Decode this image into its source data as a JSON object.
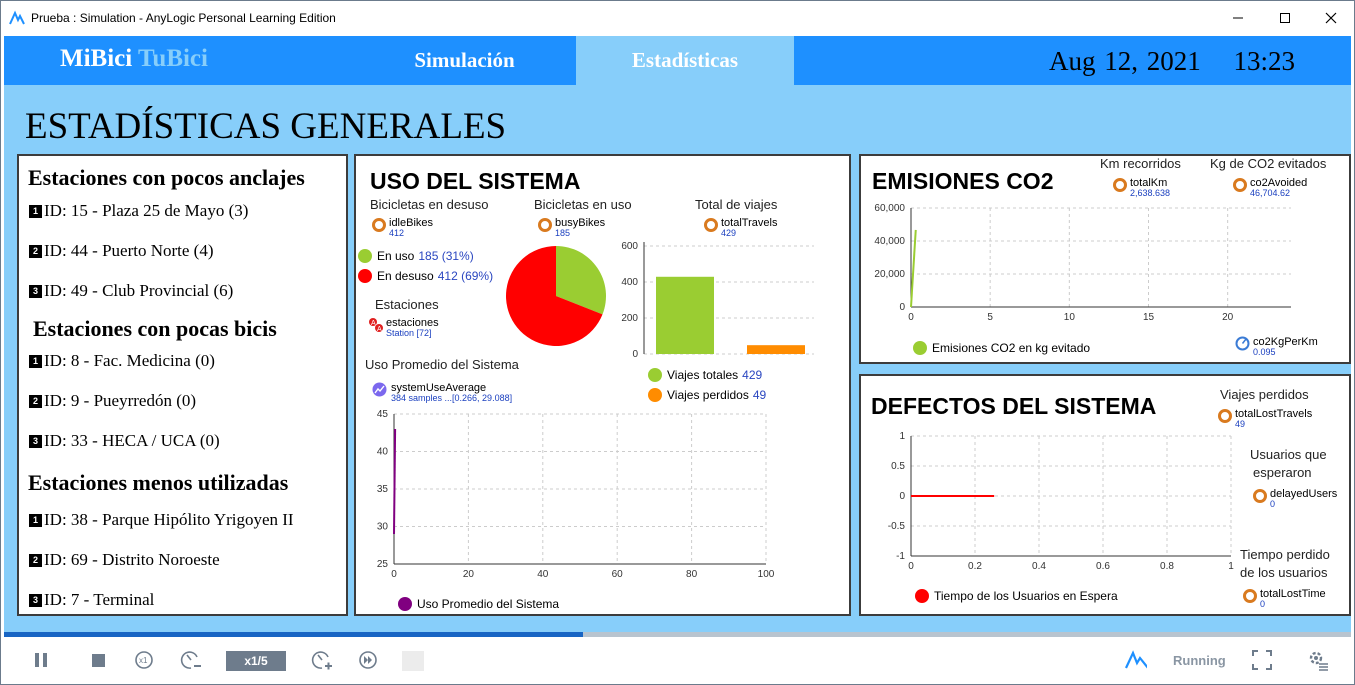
{
  "window": {
    "title": "Prueba : Simulation - AnyLogic Personal Learning Edition"
  },
  "nav": {
    "brand1": "MiBici",
    "brand2": "TuBici",
    "tabs": [
      "Simulación",
      "Estadísticas"
    ],
    "date": "Aug 12, 2021",
    "time": "13:23"
  },
  "page": {
    "title": "ESTADÍSTICAS GENERALES"
  },
  "rankings": {
    "groups": [
      {
        "title": "Estaciones con pocos anclajes",
        "items": [
          {
            "n": "1",
            "text": "ID: 15 - Plaza 25 de Mayo (3)"
          },
          {
            "n": "2",
            "text": "ID: 44 - Puerto Norte (4)"
          },
          {
            "n": "3",
            "text": "ID: 49 - Club Provincial (6)"
          }
        ]
      },
      {
        "title": "Estaciones con pocas bicis",
        "items": [
          {
            "n": "1",
            "text": "ID: 8 - Fac. Medicina (0)"
          },
          {
            "n": "2",
            "text": "ID: 9 - Pueyrredón (0)"
          },
          {
            "n": "3",
            "text": "ID: 33 - HECA / UCA (0)"
          }
        ]
      },
      {
        "title": "Estaciones menos utilizadas",
        "items": [
          {
            "n": "1",
            "text": "ID: 38 - Parque Hipólito Yrigoyen II"
          },
          {
            "n": "2",
            "text": "ID: 69 - Distrito Noroeste"
          },
          {
            "n": "3",
            "text": "ID: 7 - Terminal"
          }
        ]
      }
    ]
  },
  "uso": {
    "title": "USO DEL SISTEMA",
    "lbl_desuso": "Bicicletas en desuso",
    "lbl_enuso": "Bicicletas en uso",
    "lbl_total": "Total de viajes",
    "idle": {
      "name": "idleBikes",
      "value": "412"
    },
    "busy": {
      "name": "busyBikes",
      "value": "185"
    },
    "travels": {
      "name": "totalTravels",
      "value": "429"
    },
    "leg_enuso": "En uso",
    "leg_enuso_val": "185 (31%)",
    "leg_desuso": "En desuso",
    "leg_desuso_val": "412 (69%)",
    "lbl_estaciones": "Estaciones",
    "estaciones": {
      "name": "estaciones",
      "value": "Station [72]"
    },
    "lbl_promedio": "Uso Promedio del Sistema",
    "avg": {
      "name": "systemUseAverage",
      "value": "384 samples ...[0.266, 29.088]"
    },
    "leg_viajes_totales": "Viajes totales",
    "leg_viajes_totales_val": "429",
    "leg_viajes_perdidos": "Viajes perdidos",
    "leg_viajes_perdidos_val": "49",
    "leg_promedio": "Uso Promedio del Sistema"
  },
  "emis": {
    "title": "EMISIONES CO2",
    "lbl_km": "Km recorridos",
    "lbl_kg": "Kg de CO2 evitados",
    "km": {
      "name": "totalKm",
      "value": "2,638.638"
    },
    "co2": {
      "name": "co2Avoided",
      "value": "46,704.62"
    },
    "leg": "Emisiones CO2 en kg evitado",
    "perkm": {
      "name": "co2KgPerKm",
      "value": "0.095"
    }
  },
  "defectos": {
    "title": "DEFECTOS DEL SISTEMA",
    "lbl_perdidos": "Viajes perdidos",
    "lost": {
      "name": "totalLostTravels",
      "value": "49"
    },
    "lbl_usuarios1": "Usuarios que",
    "lbl_usuarios2": "esperaron",
    "delayed": {
      "name": "delayedUsers",
      "value": "0"
    },
    "lbl_tiempo1": "Tiempo perdido",
    "lbl_tiempo2": "de los usuarios",
    "losttime": {
      "name": "totalLostTime",
      "value": "0"
    },
    "leg": "Tiempo de los Usuarios en Espera"
  },
  "toolbar": {
    "speed": "x1/5",
    "status": "Running",
    "progress": 0.43
  },
  "colors": {
    "nav": "#1e90ff",
    "canvas": "#87cefa",
    "green": "#9acd32",
    "red": "#ff0000",
    "orange": "#ff8c00",
    "purple": "#800080"
  },
  "chart_data": [
    {
      "type": "pie",
      "categories": [
        "En uso",
        "En desuso"
      ],
      "values": [
        185,
        412
      ]
    },
    {
      "type": "bar",
      "categories": [
        "Viajes totales",
        "Viajes perdidos"
      ],
      "values": [
        429,
        49
      ],
      "ylim": [
        0,
        600
      ],
      "yticks": [
        "0",
        "200",
        "400",
        "600"
      ]
    },
    {
      "type": "line",
      "series": [
        {
          "name": "Uso Promedio del Sistema",
          "x": [
            0,
            0.3
          ],
          "y": [
            29,
            43
          ]
        }
      ],
      "xlim": [
        0,
        100
      ],
      "ylim": [
        25,
        45
      ],
      "xticks": [
        "0",
        "20",
        "40",
        "60",
        "80",
        "100"
      ],
      "yticks": [
        "25",
        "30",
        "35",
        "40",
        "45"
      ]
    },
    {
      "type": "line",
      "series": [
        {
          "name": "Emisiones CO2 en kg evitado",
          "x": [
            0,
            0.3
          ],
          "y": [
            0,
            46704.62
          ]
        }
      ],
      "xlim": [
        0,
        24
      ],
      "ylim": [
        0,
        60000
      ],
      "xticks": [
        "0",
        "5",
        "10",
        "15",
        "20"
      ],
      "yticks": [
        "0",
        "20,000",
        "40,000",
        "60,000"
      ]
    },
    {
      "type": "line",
      "series": [
        {
          "name": "Tiempo de los Usuarios en Espera",
          "x": [
            0,
            0.26
          ],
          "y": [
            0,
            0
          ]
        }
      ],
      "xlim": [
        0,
        1
      ],
      "ylim": [
        -1,
        1
      ],
      "xticks": [
        "0",
        "0.2",
        "0.4",
        "0.6",
        "0.8",
        "1"
      ],
      "yticks": [
        "-1",
        "-0.5",
        "0",
        "0.5",
        "1"
      ]
    }
  ]
}
